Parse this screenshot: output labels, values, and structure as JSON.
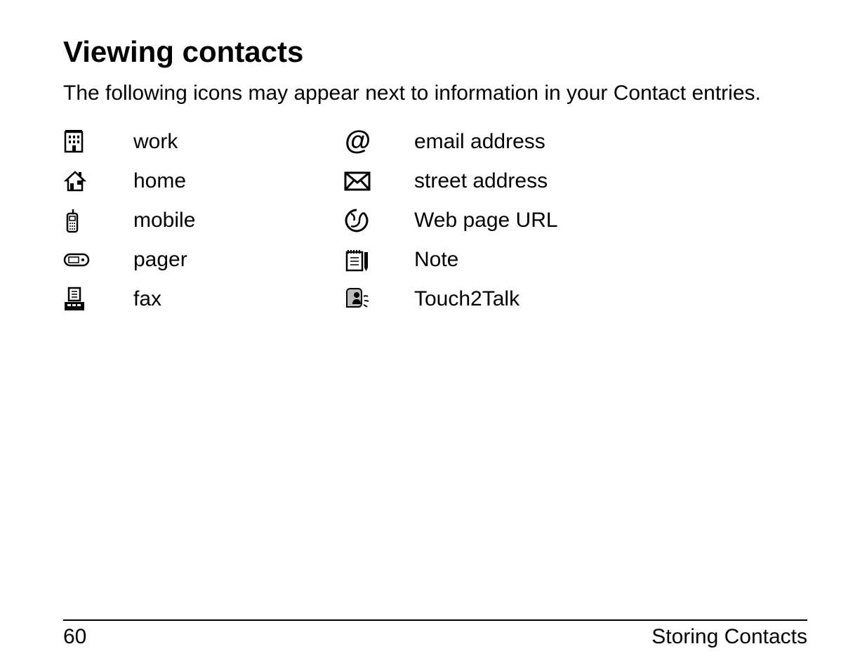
{
  "title": "Viewing contacts",
  "intro": "The following icons may appear next to information in your Contact entries.",
  "left_column": [
    {
      "icon": "building-icon",
      "label": "work"
    },
    {
      "icon": "house-icon",
      "label": "home"
    },
    {
      "icon": "mobile-phone-icon",
      "label": "mobile"
    },
    {
      "icon": "pager-icon",
      "label": "pager"
    },
    {
      "icon": "fax-icon",
      "label": "fax"
    }
  ],
  "right_column": [
    {
      "icon": "at-sign-icon",
      "label": "email address"
    },
    {
      "icon": "envelope-icon",
      "label": "street address"
    },
    {
      "icon": "globe-icon",
      "label": "Web page URL"
    },
    {
      "icon": "notepad-icon",
      "label": "Note"
    },
    {
      "icon": "talking-head-icon",
      "label": "Touch2Talk"
    }
  ],
  "footer": {
    "page_number": "60",
    "section": "Storing Contacts"
  }
}
